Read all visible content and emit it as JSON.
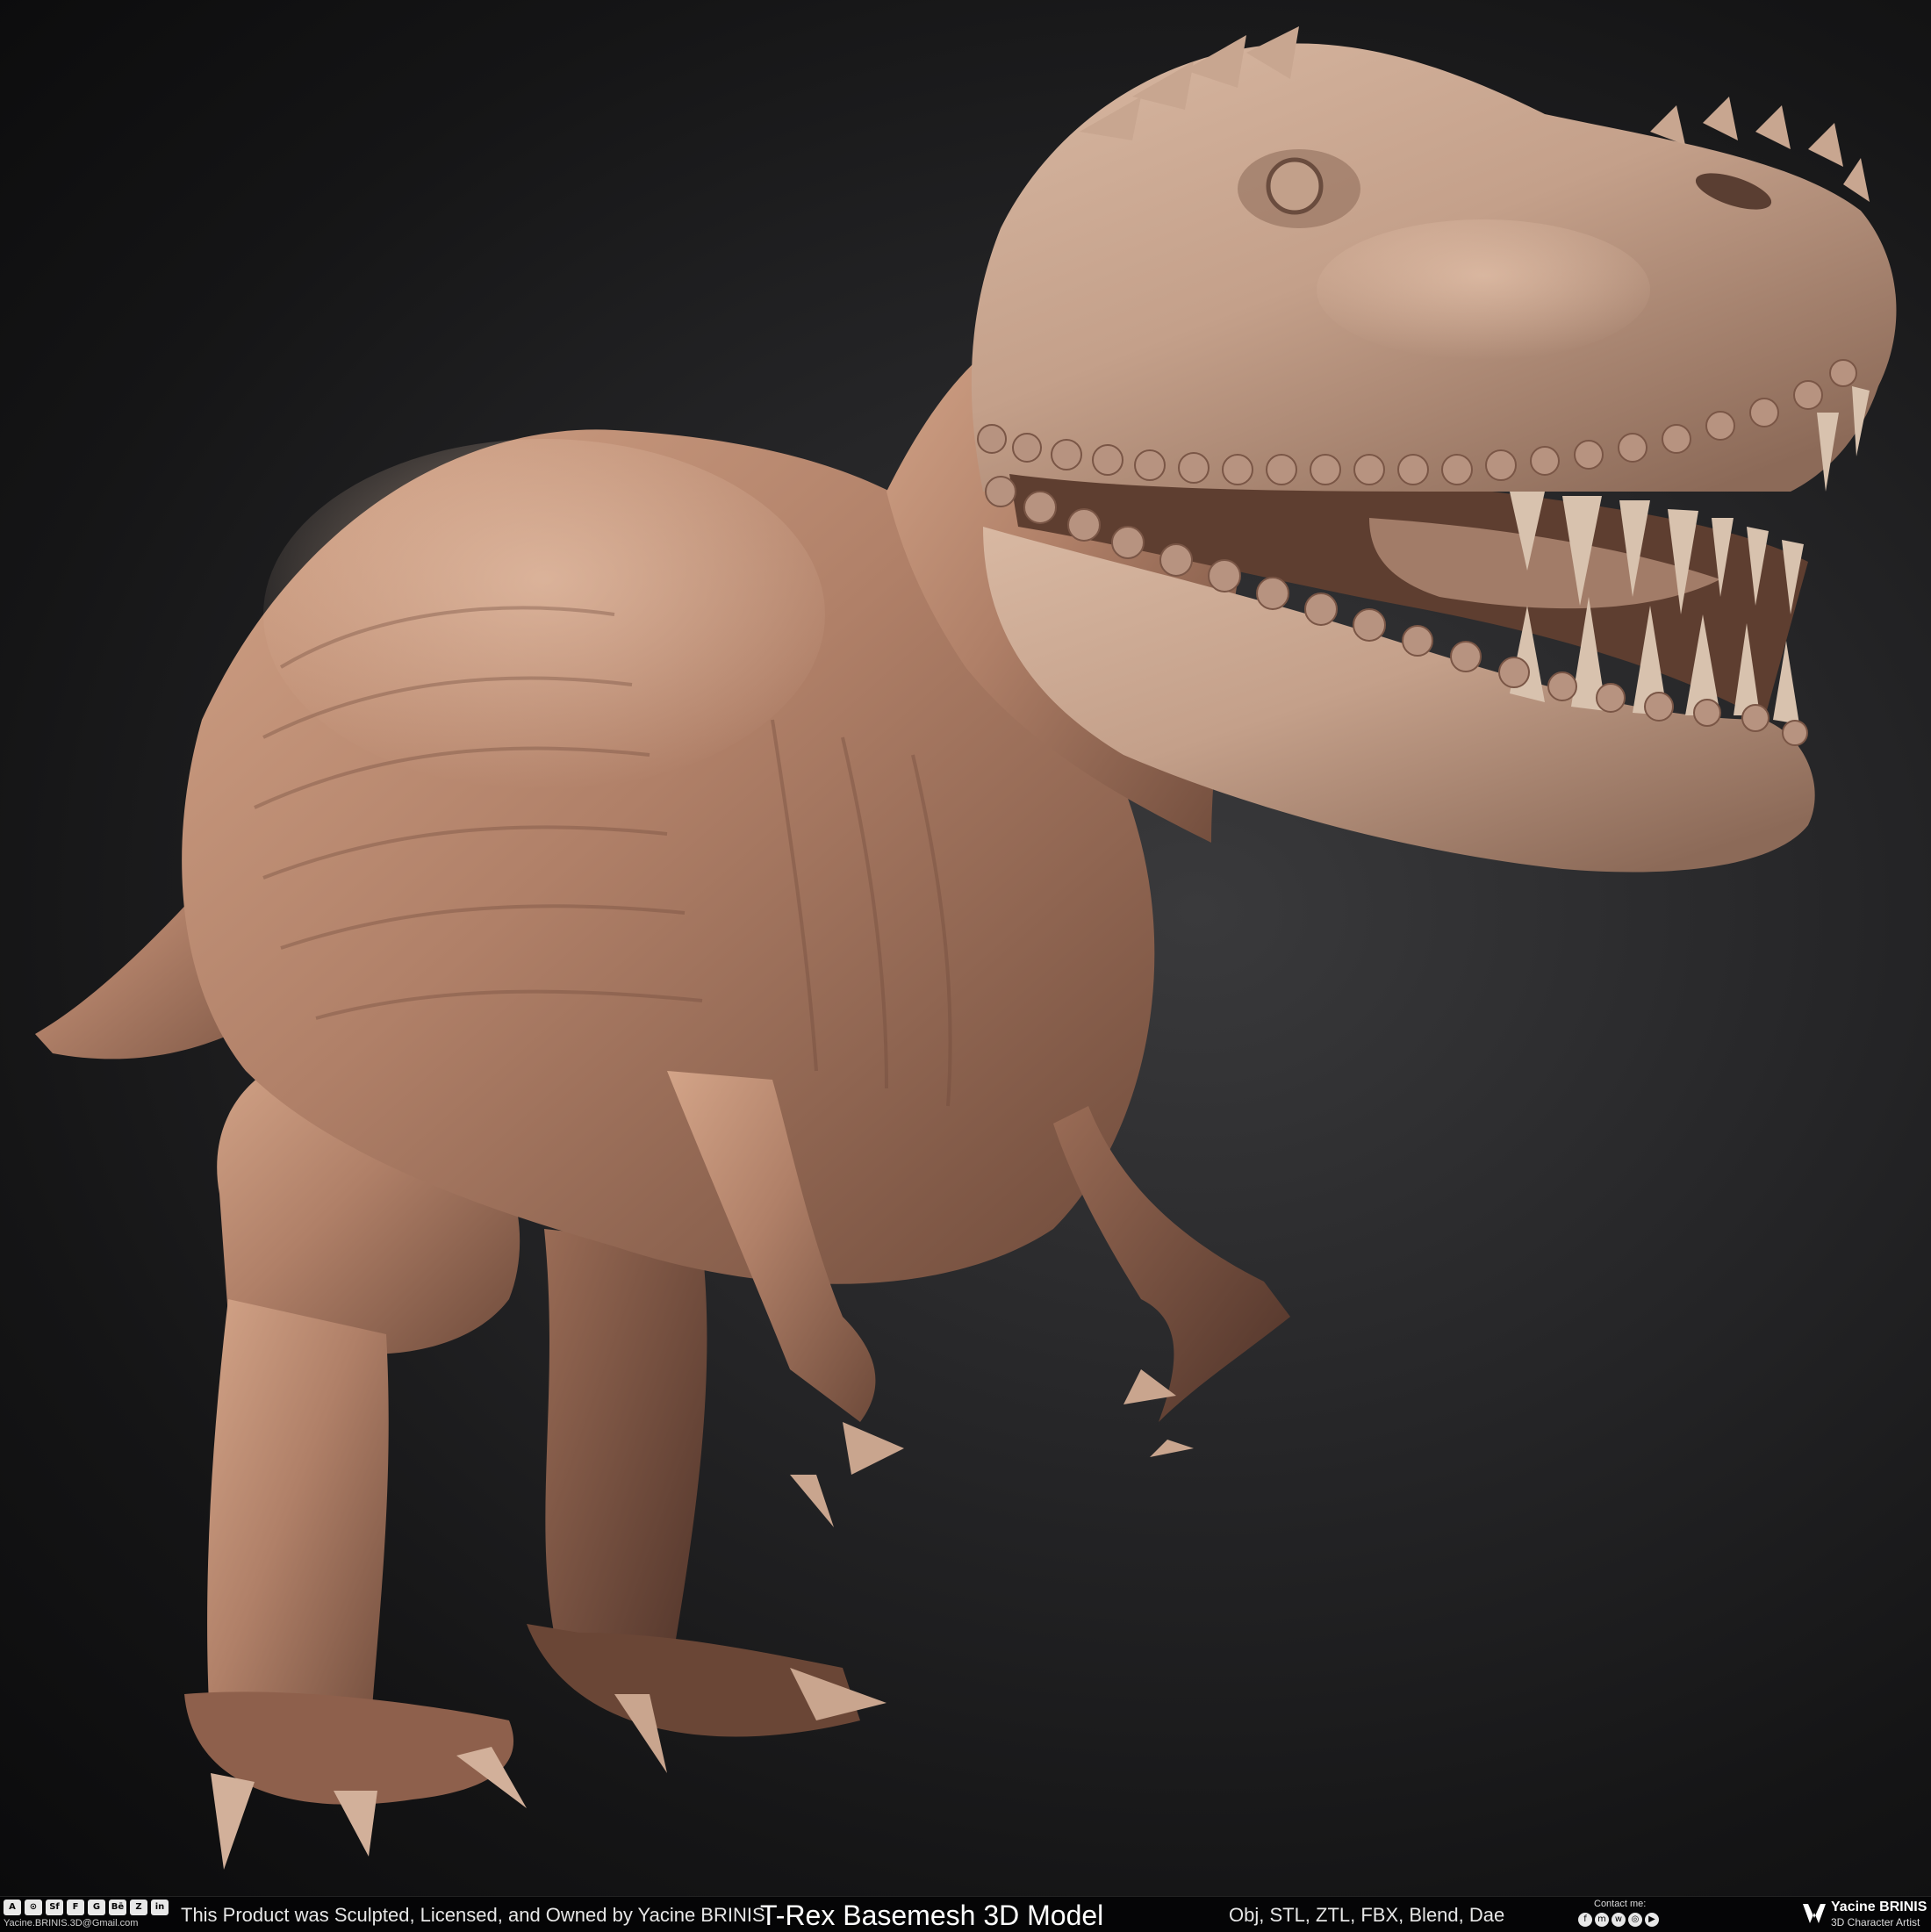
{
  "image": {
    "subject": "dinosaur-sculpt",
    "background_color": "#1d1d1f",
    "sculpt_color": "#a97a62"
  },
  "footer": {
    "social_icons": [
      {
        "icon": "artstation-icon",
        "glyph": "A"
      },
      {
        "icon": "cgtrader-icon",
        "glyph": "⊙"
      },
      {
        "icon": "sketchfab-icon",
        "glyph": "Sf"
      },
      {
        "icon": "cults-icon",
        "glyph": "F"
      },
      {
        "icon": "gumroad-icon",
        "glyph": "G"
      },
      {
        "icon": "behance-icon",
        "glyph": "Bē"
      },
      {
        "icon": "unreal-icon",
        "glyph": "Z"
      },
      {
        "icon": "linkedin-icon",
        "glyph": "in"
      }
    ],
    "email": "Yacine.BRINIS.3D@Gmail.com",
    "credit": "This Product was Sculpted, Licensed, and Owned by Yacine BRINIS",
    "title": "T-Rex Basemesh 3D Model",
    "formats": "Obj, STL, ZTL, FBX, Blend, Dae",
    "contact_label": "Contact me:",
    "contact_icons": [
      {
        "icon": "facebook-icon",
        "glyph": "f"
      },
      {
        "icon": "messenger-icon",
        "glyph": "m"
      },
      {
        "icon": "whatsapp-icon",
        "glyph": "w"
      },
      {
        "icon": "instagram-icon",
        "glyph": "◎"
      },
      {
        "icon": "youtube-icon",
        "glyph": "▶"
      }
    ],
    "brand_name": "Yacine BRINIS",
    "brand_role": "3D Character Artist"
  }
}
